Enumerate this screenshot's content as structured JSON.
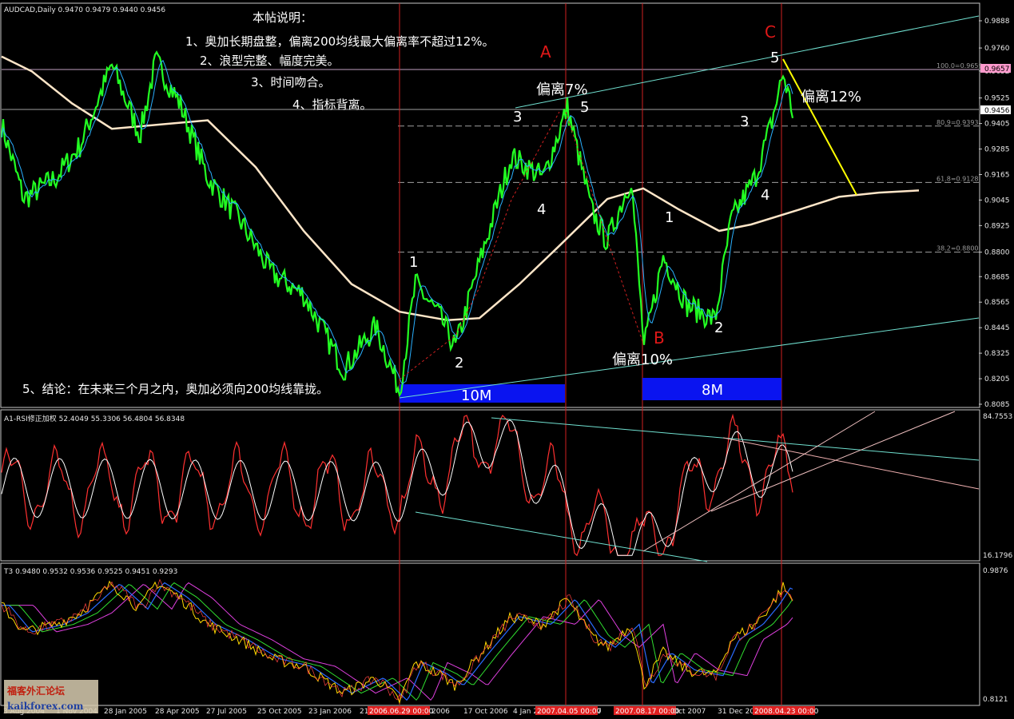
{
  "window": {
    "header_main": "AUDCAD,Daily  0.9470 0.9479 0.9440 0.9456",
    "header_rsi": "A1-RSI修正加权 52.4049 55.3306 56.4804 56.8348",
    "header_t3": "T3 0.9480 0.9532 0.9536 0.9525 0.9451 0.9293"
  },
  "notes": {
    "title": "本帖说明：",
    "items": [
      "1、奥加长期盘整，偏离200均线最大偏离率不超过12%。",
      "2、浪型完整、幅度完美。",
      "3、时间吻合。",
      "4、指标背离。"
    ],
    "conclusion": "5、结论：在未来三个月之内，奥加必须向200均线靠拢。"
  },
  "annotations": {
    "wave_labels": [
      "1",
      "2",
      "3",
      "4",
      "5",
      "1",
      "2",
      "3",
      "4",
      "5"
    ],
    "abc": [
      "A",
      "B",
      "C"
    ],
    "deviations": [
      "偏离7%",
      "偏离10%",
      "偏离12%"
    ],
    "boxes": [
      "10M",
      "8M"
    ]
  },
  "fib_levels": [
    {
      "label": "100.0=0.9659",
      "price": 0.9659
    },
    {
      "label": "80.9=0.9393",
      "price": 0.9393
    },
    {
      "label": "61.8=0.9128",
      "price": 0.9128
    },
    {
      "label": "38.2=0.8800",
      "price": 0.88
    }
  ],
  "price_tags": {
    "ask": "0.9657",
    "bid": "0.9456"
  },
  "x_axis": {
    "labels": [
      "3 Aug 2004",
      "1 Nov 2004",
      "28 Jan 2005",
      "28 Apr 2005",
      "27 Jul 2005",
      "25 Oct 2005",
      "23 Jan 2006",
      "21",
      "2006.06.29 00:00",
      "2006",
      "17 Oct 2006",
      "4 Jan 2",
      "2007.04.05 00:00",
      "7",
      "2007.08.17 00:00",
      "Oct 2007",
      "31 Dec 200",
      "2008.04.23 00:00"
    ]
  },
  "colors": {
    "price": "#22ff22",
    "ma_fast": "#2ab0ff",
    "ma200": "#ffe6c8",
    "rsi_red": "#ff3030",
    "rsi_white": "#ffffff",
    "t3_yellow": "#ffd800",
    "t3_blue": "#2a6bff",
    "t3_green": "#30e030",
    "t3_magenta": "#e040e0",
    "vline": "#d02020",
    "box": "#0a14f0",
    "fib": "#a0a0a0",
    "trend_cyan": "#70e0d0",
    "yellow_line": "#ffff00"
  },
  "chart_data": [
    {
      "type": "line",
      "title": "AUDCAD,Daily",
      "ylim": [
        0.8085,
        0.9888
      ],
      "y_ticks": [
        0.9888,
        0.976,
        0.9652,
        0.9525,
        0.9405,
        0.9285,
        0.9165,
        0.9045,
        0.8925,
        0.88,
        0.8685,
        0.8565,
        0.8445,
        0.8325,
        0.8205,
        0.8085
      ],
      "x": [
        "2004-08-03",
        "2004-11-01",
        "2005-01-28",
        "2005-04-28",
        "2005-07-27",
        "2005-10-25",
        "2006-01-23",
        "2006-06-29",
        "2006-10-17",
        "2007-01-04",
        "2007-04-05",
        "2007-08-17",
        "2007-10-15",
        "2007-12-31",
        "2008-04-23"
      ],
      "series": [
        {
          "name": "",
          "values": [
            0.94,
            0.91,
            0.96,
            0.962,
            0.925,
            0.87,
            0.83,
            0.815,
            0.865,
            0.92,
            0.95,
            0.835,
            0.89,
            0.86,
            0.965
          ]
        }
      ]
    },
    {
      "type": "line",
      "title": "A1-RSI修正加权",
      "ylim": [
        16.1796,
        84.7553
      ],
      "y_ticks": [
        84.7553,
        16.1796
      ],
      "series": [
        {
          "name": "",
          "values": [
            52.4049,
            55.3306,
            56.4804,
            56.8348
          ]
        }
      ]
    },
    {
      "type": "line",
      "title": "T3",
      "ylim": [
        0.8121,
        0.9876
      ],
      "y_ticks": [
        0.9876,
        0.8121
      ],
      "series": [
        {
          "name": "",
          "values": [
            0.948,
            0.9532,
            0.9536,
            0.9525,
            0.9451,
            0.9293
          ]
        }
      ]
    }
  ],
  "watermark": {
    "line1": "福客外汇论坛",
    "line2": "kaikforex.com"
  }
}
